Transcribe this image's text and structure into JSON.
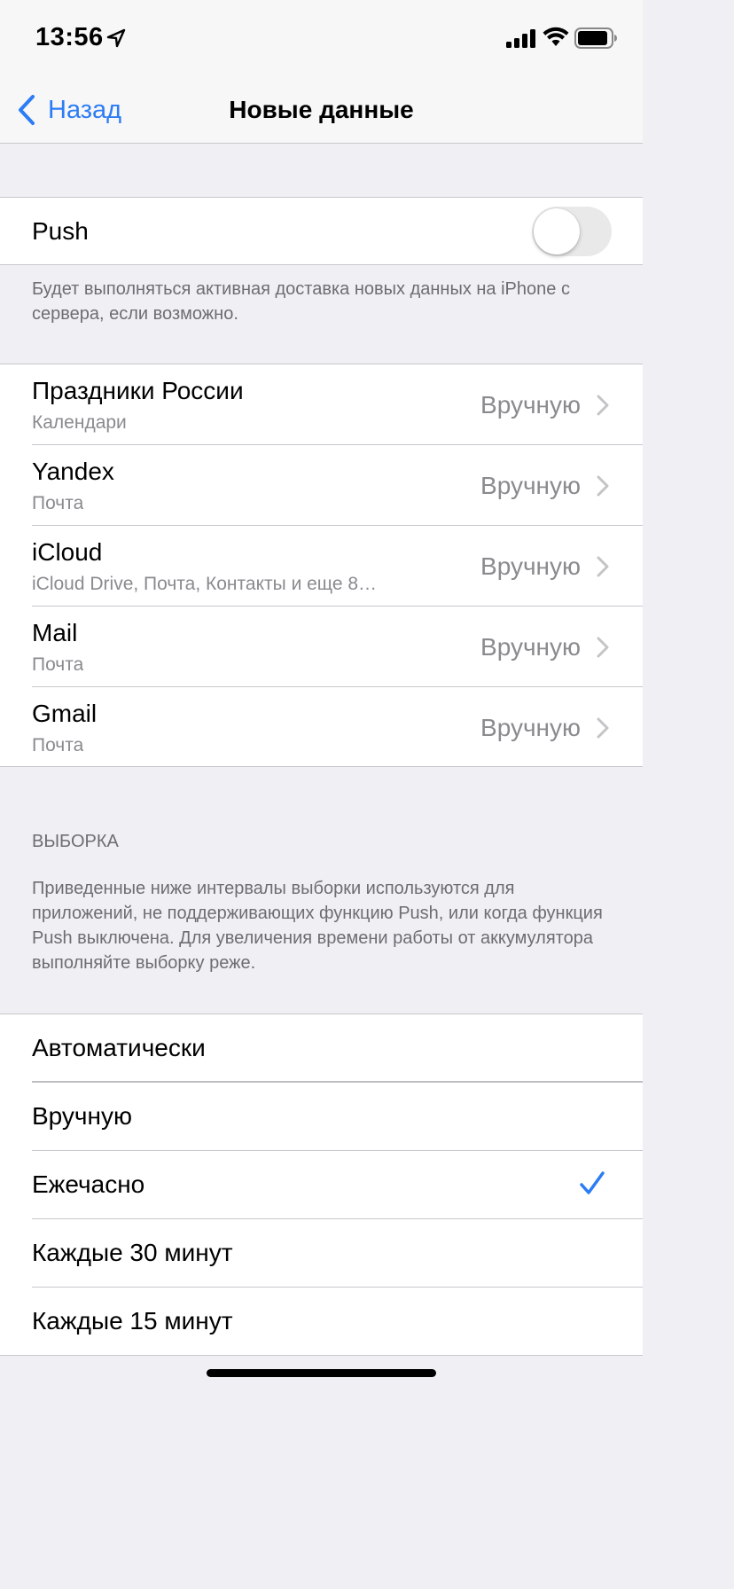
{
  "status_bar": {
    "time": "13:56"
  },
  "nav": {
    "back_label": "Назад",
    "title": "Новые данные"
  },
  "push": {
    "label": "Push",
    "enabled": false,
    "footer": "Будет выполняться активная доставка новых данных на iPhone с сервера, если возможно."
  },
  "accounts": [
    {
      "name": "Праздники России",
      "detail": "Календари",
      "value": "Вручную"
    },
    {
      "name": "Yandex",
      "detail": "Почта",
      "value": "Вручную"
    },
    {
      "name": "iCloud",
      "detail": "iCloud Drive, Почта, Контакты и еще 8…",
      "value": "Вручную"
    },
    {
      "name": "Mail",
      "detail": "Почта",
      "value": "Вручную"
    },
    {
      "name": "Gmail",
      "detail": "Почта",
      "value": "Вручную"
    }
  ],
  "fetch": {
    "header": "ВЫБОРКА",
    "description": "Приведенные ниже интервалы выборки используются для приложений, не поддерживающих функцию Push, или когда функция Push выключена. Для увеличения времени работы от аккумулятора выполняйте выборку реже.",
    "options": [
      {
        "label": "Автоматически",
        "selected": false
      },
      {
        "label": "Вручную",
        "selected": false
      },
      {
        "label": "Ежечасно",
        "selected": true
      },
      {
        "label": "Каждые 30 минут",
        "selected": false
      },
      {
        "label": "Каждые 15 минут",
        "selected": false
      }
    ]
  },
  "colors": {
    "accent": "#2c7cf6",
    "background": "#efeff4",
    "secondary_text": "#8a8a8f"
  }
}
